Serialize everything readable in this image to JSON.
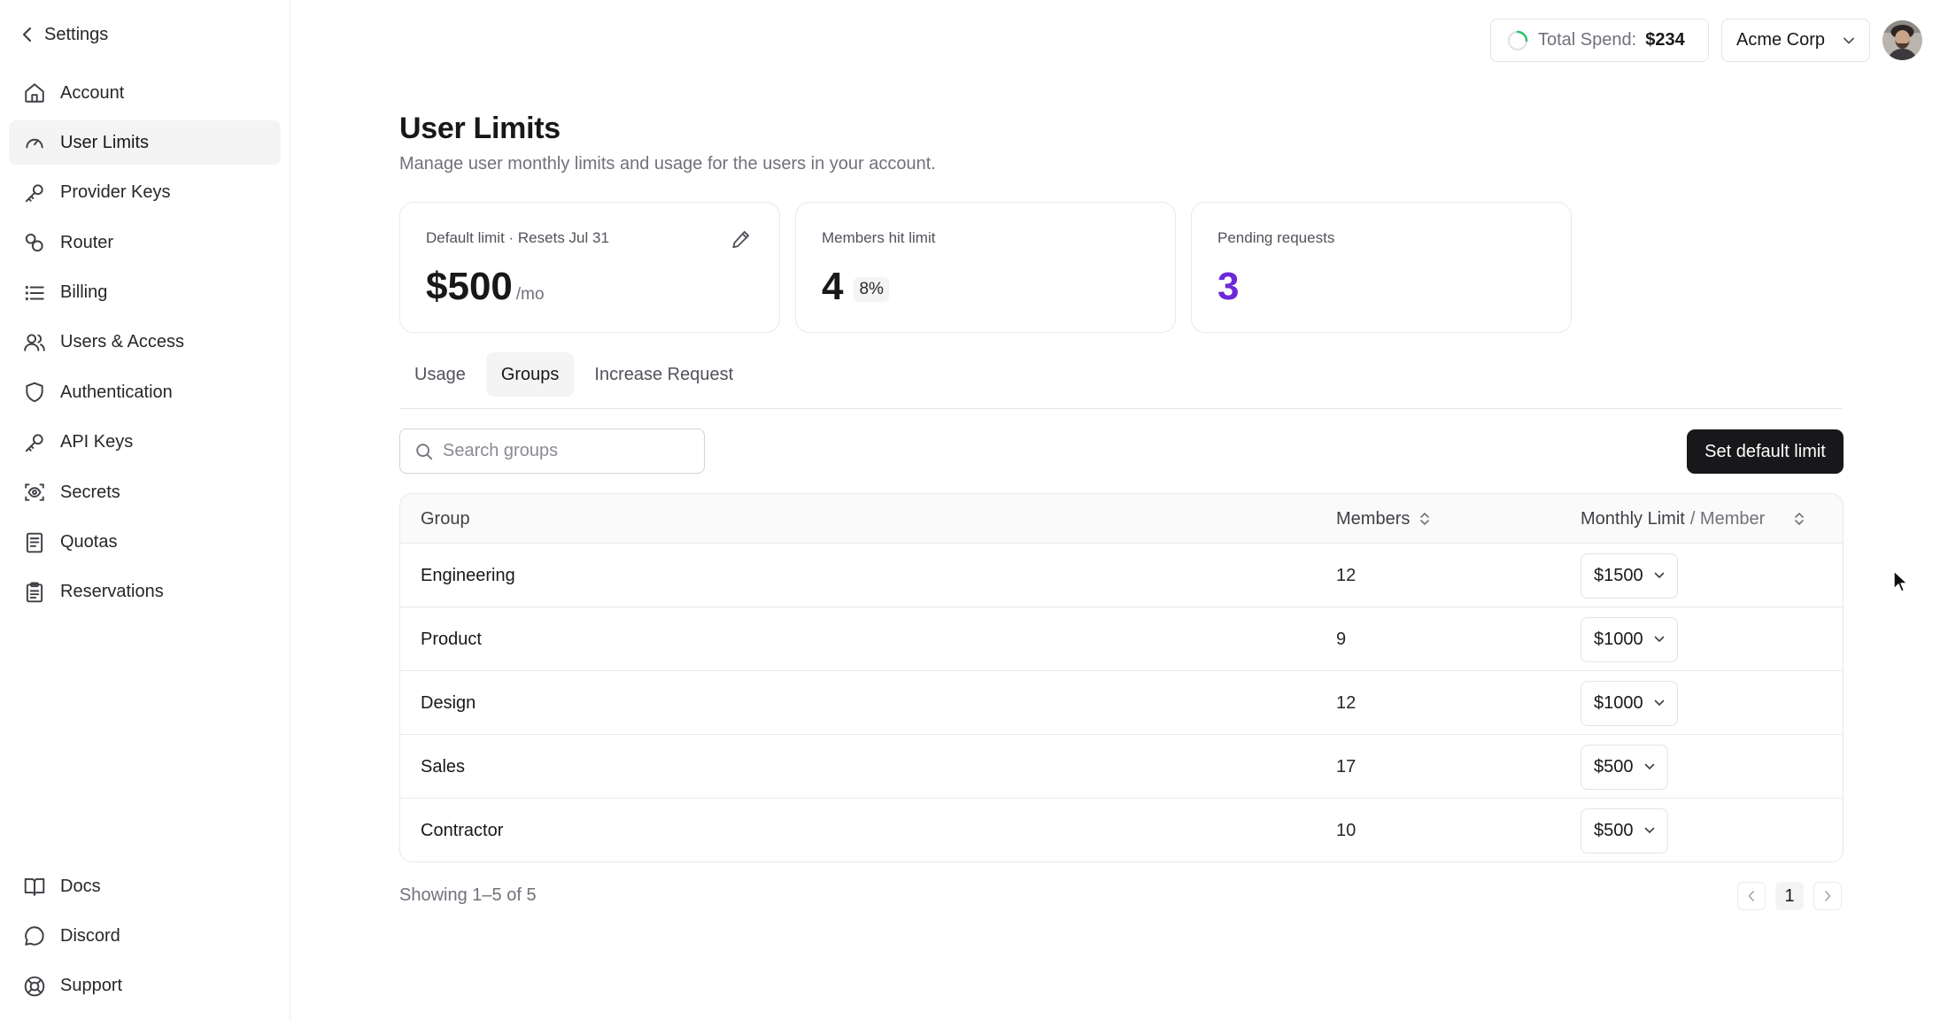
{
  "sidebar": {
    "back_label": "Settings",
    "items": [
      {
        "label": "Account",
        "icon": "home-icon"
      },
      {
        "label": "User Limits",
        "icon": "gauge-icon",
        "active": true
      },
      {
        "label": "Provider Keys",
        "icon": "key-icon"
      },
      {
        "label": "Router",
        "icon": "route-icon"
      },
      {
        "label": "Billing",
        "icon": "list-icon"
      },
      {
        "label": "Users & Access",
        "icon": "users-icon"
      },
      {
        "label": "Authentication",
        "icon": "shield-icon"
      },
      {
        "label": "API Keys",
        "icon": "key-icon"
      },
      {
        "label": "Secrets",
        "icon": "scan-eye-icon"
      },
      {
        "label": "Quotas",
        "icon": "receipt-icon"
      },
      {
        "label": "Reservations",
        "icon": "clipboard-icon"
      }
    ],
    "bottom_items": [
      {
        "label": "Docs",
        "icon": "book-icon"
      },
      {
        "label": "Discord",
        "icon": "chat-bubble-icon"
      },
      {
        "label": "Support",
        "icon": "lifebuoy-icon"
      }
    ]
  },
  "topbar": {
    "spend_label": "Total Spend:",
    "spend_value": "$234",
    "org_name": "Acme Corp"
  },
  "page": {
    "title": "User Limits",
    "subtitle": "Manage user monthly limits and usage for the users in your account."
  },
  "cards": {
    "default_limit": {
      "label": "Default limit · Resets Jul 31",
      "value": "$500",
      "unit": "/mo"
    },
    "members_hit": {
      "label": "Members hit limit",
      "value": "4",
      "percent": "8%"
    },
    "pending": {
      "label": "Pending requests",
      "value": "3"
    }
  },
  "tabs": [
    "Usage",
    "Groups",
    "Increase Request"
  ],
  "active_tab": "Groups",
  "toolbar": {
    "search_placeholder": "Search groups",
    "default_button": "Set default limit"
  },
  "table": {
    "headers": {
      "group": "Group",
      "members": "Members",
      "limit_main": "Monthly Limit",
      "limit_sep": "/ Member"
    },
    "rows": [
      {
        "group": "Engineering",
        "members": "12",
        "limit": "$1500"
      },
      {
        "group": "Product",
        "members": "9",
        "limit": "$1000"
      },
      {
        "group": "Design",
        "members": "12",
        "limit": "$1000"
      },
      {
        "group": "Sales",
        "members": "17",
        "limit": "$500"
      },
      {
        "group": "Contractor",
        "members": "10",
        "limit": "$500"
      }
    ]
  },
  "footer": {
    "showing": "Showing 1–5 of 5",
    "page": "1"
  },
  "colors": {
    "accent_purple": "#6d28d9",
    "primary_button": "#18181b",
    "spinner_green": "#22c55e"
  }
}
